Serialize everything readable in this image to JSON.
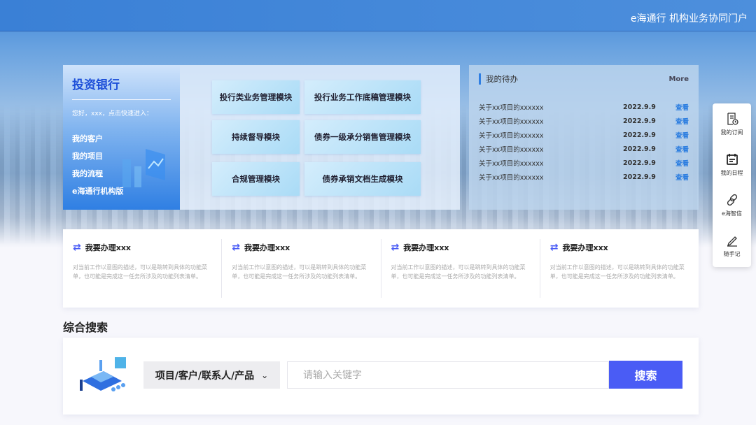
{
  "header": {
    "title": "e海通行 机构业务协同门户"
  },
  "bank": {
    "title": "投资银行",
    "greeting": "您好，xxx，点击快速进入：",
    "links": [
      "我的客户",
      "我的项目",
      "我的流程",
      "e海通行机构版"
    ]
  },
  "modules": [
    "投行类业务管理模块",
    "投行业务工作底稿管理模块",
    "持续督导模块",
    "债券一级承分销售管理模块",
    "合规管理模块",
    "债券承销文档生成模块"
  ],
  "todo": {
    "title": "我的待办",
    "more": "More",
    "items": [
      {
        "name": "关于xx项目的xxxxxx",
        "date": "2022.9.9",
        "action": "查看"
      },
      {
        "name": "关于xx项目的xxxxxx",
        "date": "2022.9.9",
        "action": "查看"
      },
      {
        "name": "关于xx项目的xxxxxx",
        "date": "2022.9.9",
        "action": "查看"
      },
      {
        "name": "关于xx项目的xxxxxx",
        "date": "2022.9.9",
        "action": "查看"
      },
      {
        "name": "关于xx项目的xxxxxx",
        "date": "2022.9.9",
        "action": "查看"
      },
      {
        "name": "关于xx项目的xxxxxx",
        "date": "2022.9.9",
        "action": "查看"
      }
    ]
  },
  "side": [
    "我的订阅",
    "我的日程",
    "e海智信",
    "随手记"
  ],
  "tasks": [
    {
      "title": "我要办理xxx",
      "desc": "对当前工作以意图的描述，可以是跳转到具体的功能菜单，也可能是完成这一任务所涉及的功能列表清单。"
    },
    {
      "title": "我要办理xxx",
      "desc": "对当前工作以意图的描述，可以是跳转到具体的功能菜单，也可能是完成这一任务所涉及的功能列表清单。"
    },
    {
      "title": "我要办理xxx",
      "desc": "对当前工作以意图的描述，可以是跳转到具体的功能菜单，也可能是完成这一任务所涉及的功能列表清单。"
    },
    {
      "title": "我要办理xxx",
      "desc": "对当前工作以意图的描述，可以是跳转到具体的功能菜单，也可能是完成这一任务所涉及的功能列表清单。"
    }
  ],
  "search": {
    "title": "综合搜索",
    "scope": "项目/客户/联系人/产品",
    "placeholder": "请输入关键字",
    "button": "搜索"
  }
}
